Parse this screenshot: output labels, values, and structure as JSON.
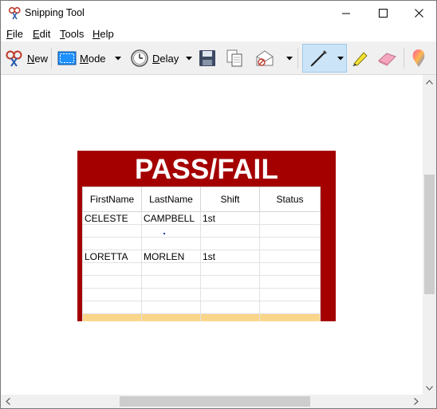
{
  "window": {
    "title": "Snipping Tool"
  },
  "menu": [
    {
      "label": "File",
      "underline": "F",
      "rest": "ile"
    },
    {
      "label": "Edit",
      "underline": "E",
      "rest": "dit"
    },
    {
      "label": "Tools",
      "underline": "T",
      "rest": "ools"
    },
    {
      "label": "Help",
      "underline": "H",
      "rest": "elp"
    }
  ],
  "toolbar": {
    "new_label": {
      "underline": "N",
      "rest": "ew"
    },
    "mode_label": {
      "underline": "M",
      "rest": "ode"
    },
    "delay_label": {
      "underline": "D",
      "rest": "elay"
    }
  },
  "snip": {
    "title": "PASS/FAIL",
    "columns": [
      "FirstName",
      "LastName",
      "Shift",
      "Status"
    ],
    "rows": [
      [
        "CELESTE",
        "CAMPBELL",
        "1st",
        ""
      ],
      [
        "",
        "",
        "",
        ""
      ],
      [
        "",
        "",
        "",
        ""
      ],
      [
        "LORETTA",
        "MORLEN",
        "1st",
        ""
      ],
      [
        "",
        "",
        "",
        ""
      ],
      [
        "",
        "",
        "",
        ""
      ],
      [
        "",
        "",
        "",
        ""
      ],
      [
        "",
        "",
        "",
        ""
      ],
      [
        "",
        "",
        "",
        ""
      ]
    ]
  },
  "colors": {
    "sheet_bg": "#a50000",
    "highlight_row": "#fad58a",
    "pen_active": "#cce4f7"
  }
}
